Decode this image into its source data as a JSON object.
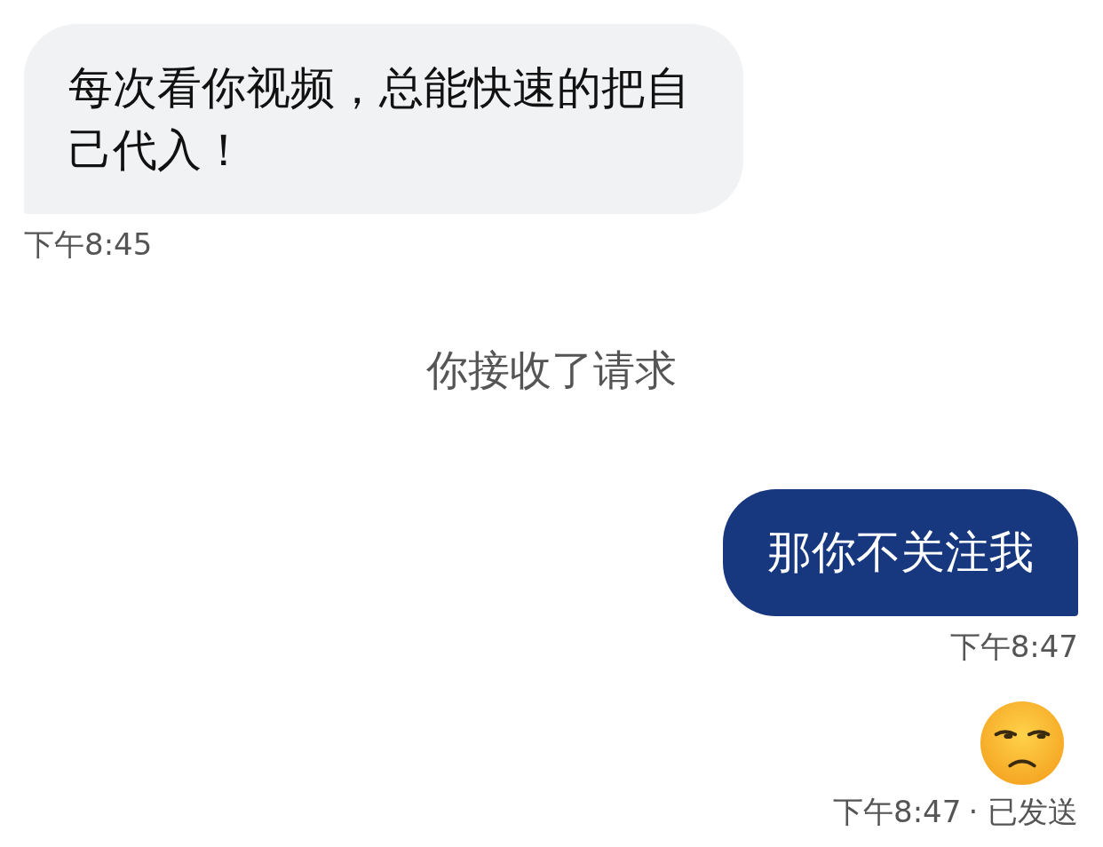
{
  "messages": [
    {
      "kind": "received",
      "text": "每次看你视频，总能快速的把自己代入！",
      "time": "下午8:45"
    },
    {
      "kind": "system",
      "text": "你接收了请求"
    },
    {
      "kind": "sent_text",
      "text": "那你不关注我",
      "time": "下午8:47"
    },
    {
      "kind": "sent_emoji",
      "time": "下午8:47",
      "status": "· 已发送"
    }
  ]
}
